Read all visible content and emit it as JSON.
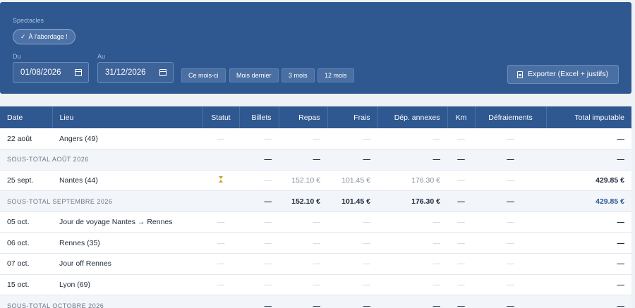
{
  "filters": {
    "spectacles_label": "Spectacles",
    "chip_check": "✓",
    "chip_label": "À l'abordage !",
    "du_label": "Du",
    "au_label": "Au",
    "date_from": "01/08/2026",
    "date_to": "31/12/2026",
    "presets": [
      "Ce mois-ci",
      "Mois dernier",
      "3 mois",
      "12 mois"
    ],
    "export_label": "Exporter (Excel + justifs)"
  },
  "table": {
    "columns": [
      "Date",
      "Lieu",
      "Statut",
      "Billets",
      "Repas",
      "Frais",
      "Dép. annexes",
      "Km",
      "Défraiements",
      "Total imputable"
    ],
    "rows": [
      {
        "type": "row",
        "date": "22 août",
        "lieu": "Angers (49)",
        "statut": "—",
        "billets": "—",
        "repas": "—",
        "frais": "—",
        "dep": "—",
        "km": "—",
        "defr": "—",
        "total": "—"
      },
      {
        "type": "sub",
        "label": "SOUS-TOTAL AOÛT 2026",
        "billets": "—",
        "repas": "—",
        "frais": "—",
        "dep": "—",
        "km": "—",
        "defr": "—",
        "total": "—"
      },
      {
        "type": "row",
        "date": "25 sept.",
        "lieu": "Nantes (44)",
        "statut": "hourglass",
        "billets": "—",
        "repas": "152.10 €",
        "frais": "101.45 €",
        "dep": "176.30 €",
        "km": "—",
        "defr": "—",
        "total": "429.85 €"
      },
      {
        "type": "sub",
        "label": "SOUS-TOTAL SEPTEMBRE 2026",
        "billets": "—",
        "repas": "152.10 €",
        "frais": "101.45 €",
        "dep": "176.30 €",
        "km": "—",
        "defr": "—",
        "total": "429.85 €"
      },
      {
        "type": "row",
        "date": "05 oct.",
        "lieu": "Jour de voyage Nantes → Rennes",
        "statut": "—",
        "billets": "—",
        "repas": "—",
        "frais": "—",
        "dep": "—",
        "km": "—",
        "defr": "—",
        "total": "—"
      },
      {
        "type": "row",
        "date": "06 oct.",
        "lieu": "Rennes (35)",
        "statut": "—",
        "billets": "—",
        "repas": "—",
        "frais": "—",
        "dep": "—",
        "km": "—",
        "defr": "—",
        "total": "—"
      },
      {
        "type": "row",
        "date": "07 oct.",
        "lieu": "Jour off Rennes",
        "statut": "—",
        "billets": "—",
        "repas": "—",
        "frais": "—",
        "dep": "—",
        "km": "—",
        "defr": "—",
        "total": "—"
      },
      {
        "type": "row",
        "date": "15 oct.",
        "lieu": "Lyon (69)",
        "statut": "—",
        "billets": "—",
        "repas": "—",
        "frais": "—",
        "dep": "—",
        "km": "—",
        "defr": "—",
        "total": "—"
      },
      {
        "type": "sub",
        "label": "SOUS-TOTAL OCTOBRE 2026",
        "billets": "—",
        "repas": "—",
        "frais": "—",
        "dep": "—",
        "km": "—",
        "defr": "—",
        "total": "—"
      }
    ]
  },
  "colors": {
    "header_blue": "#2f5890",
    "total_blue": "#2f5890",
    "pending_amber": "#c7a227"
  }
}
